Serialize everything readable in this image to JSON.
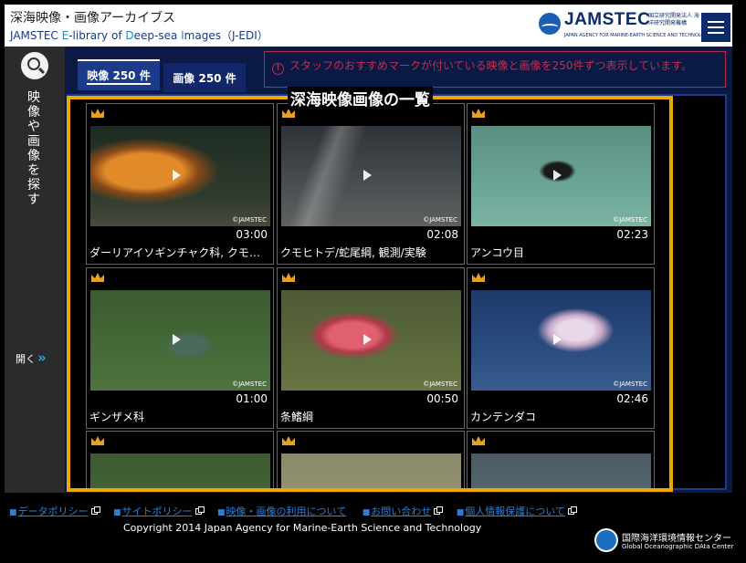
{
  "header": {
    "title": "深海映像・画像アーカイブス",
    "subtitle_parts": [
      "JAMSTEC ",
      "E",
      "-library of ",
      "D",
      "eep-sea ",
      "I",
      "mages（J-EDI）"
    ],
    "logo_text": "JAMSTEC",
    "logo_jp": "国立研究開発法人 海洋研究開発機構",
    "logo_en": "JAPAN AGENCY FOR MARINE-EARTH SCIENCE AND TECHNOLOGY",
    "menu_icon": "hamburger-icon"
  },
  "rail": {
    "search_icon": "search-icon",
    "label": "映像や画像を探す",
    "open_label": "開く",
    "open_icon": "»"
  },
  "tabs": [
    {
      "label": "映像 250 件",
      "active": true
    },
    {
      "label": "画像 250 件",
      "active": false
    }
  ],
  "notice": {
    "icon": "!",
    "text": "スタッフのおすすめマークが付いている映像と画像を250件ずつ表示しています。"
  },
  "highlight_label": "深海映像画像の一覧",
  "videos": [
    {
      "duration": "03:00",
      "caption": "ダーリアイソギンチャク科, クモヒトデ綱",
      "watermark": "©JAMSTEC",
      "scene": "anemone"
    },
    {
      "duration": "02:08",
      "caption": "クモヒトデ/蛇尾綱, 観測/実験",
      "watermark": "©JAMSTEC",
      "scene": "brittlestar"
    },
    {
      "duration": "02:23",
      "caption": "アンコウ目",
      "watermark": "©JAMSTEC",
      "scene": "anglerfish"
    },
    {
      "duration": "01:00",
      "caption": "ギンザメ科",
      "watermark": "©JAMSTEC",
      "scene": "chimaera"
    },
    {
      "duration": "00:50",
      "caption": "条鰭綱",
      "watermark": "©JAMSTEC",
      "scene": "redfish"
    },
    {
      "duration": "02:46",
      "caption": "カンテンダコ",
      "watermark": "©JAMSTEC",
      "scene": "octopus"
    },
    {
      "duration": "",
      "caption": "",
      "watermark": "",
      "scene": "seafloor1"
    },
    {
      "duration": "",
      "caption": "",
      "watermark": "",
      "scene": "seafloor2"
    },
    {
      "duration": "",
      "caption": "",
      "watermark": "",
      "scene": "seafloor3"
    }
  ],
  "footer": {
    "links": [
      "データポリシー",
      "サイトポリシー",
      "映像・画像の利用について",
      "お問い合わせ",
      "個人情報保護について"
    ],
    "copyright": "Copyright 2014 Japan Agency for Marine-Earth Science and Technology",
    "godac_jp": "国際海洋環境情報センター",
    "godac_en": "Global Oceanographic DAta Center"
  },
  "colors": {
    "accent_blue": "#1b3a8a",
    "highlight": "#f0a800",
    "notice_red": "#c0304f",
    "link_blue": "#2a7fd4"
  }
}
